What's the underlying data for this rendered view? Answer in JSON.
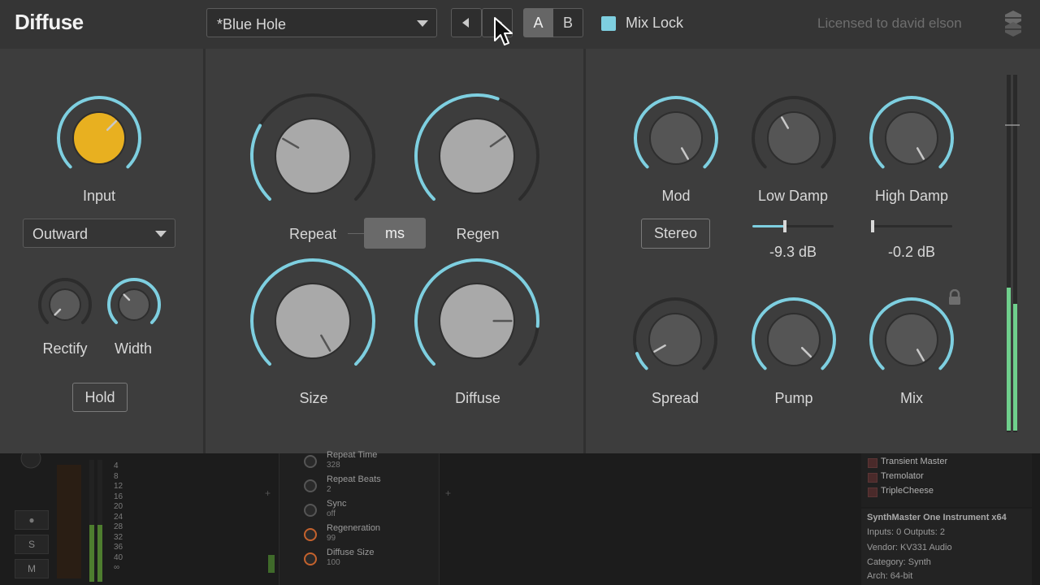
{
  "header": {
    "plugin_name": "Diffuse",
    "preset_name": "*Blue Hole",
    "ab": {
      "a_label": "A",
      "b_label": "B",
      "active": "A"
    },
    "mix_lock_label": "Mix Lock",
    "mix_lock_checked": true,
    "license_text": "Licensed to david elson"
  },
  "colors": {
    "accent": "#7ecfe0",
    "input_knob": "#e8b020",
    "background": "#3d3d3d"
  },
  "input_section": {
    "input_label": "Input",
    "mode_value": "Outward",
    "rectify_label": "Rectify",
    "width_label": "Width",
    "hold_label": "Hold"
  },
  "center_section": {
    "repeat_label": "Repeat",
    "ms_label": "ms",
    "regen_label": "Regen",
    "size_label": "Size",
    "diffuse_label": "Diffuse"
  },
  "right_section": {
    "mod_label": "Mod",
    "low_damp_label": "Low Damp",
    "high_damp_label": "High Damp",
    "stereo_label": "Stereo",
    "low_damp_value": "-9.3 dB",
    "high_damp_value": "-0.2 dB",
    "spread_label": "Spread",
    "pump_label": "Pump",
    "mix_label": "Mix"
  },
  "host": {
    "meter_scale": [
      "4",
      "8",
      "12",
      "16",
      "20",
      "24",
      "28",
      "32",
      "36",
      "40",
      "∞"
    ],
    "channel_buttons": [
      "S",
      "M"
    ],
    "params": [
      {
        "name": "Repeat Time",
        "value": "328"
      },
      {
        "name": "Repeat Beats",
        "value": "2"
      },
      {
        "name": "Sync",
        "value": "off"
      },
      {
        "name": "Regeneration",
        "value": "99"
      },
      {
        "name": "Diffuse Size",
        "value": "100"
      }
    ],
    "browser_items": [
      "Transient Master",
      "Tremolator",
      "TripleCheese"
    ],
    "info": {
      "title": "SynthMaster One Instrument x64",
      "io": "Inputs: 0   Outputs: 2",
      "vendor": "Vendor: KV331 Audio",
      "category": "Category: Synth",
      "arch": "Arch: 64-bit"
    }
  }
}
